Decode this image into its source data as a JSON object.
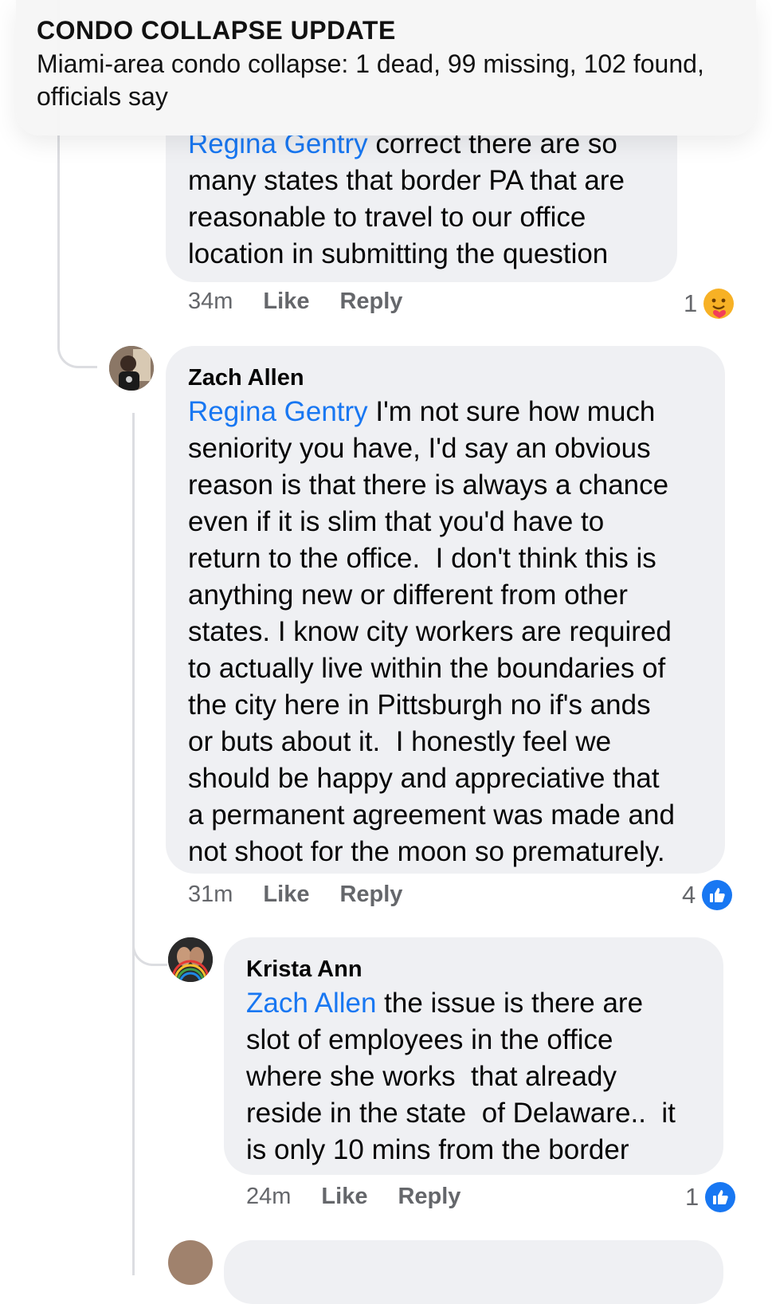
{
  "notification": {
    "title": "CONDO COLLAPSE UPDATE",
    "text": "Miami-area condo collapse: 1 dead, 99 missing, 102 found, officials say"
  },
  "comments": [
    {
      "author": "",
      "mention": "Regina Gentry",
      "text": " correct there are so\nmany states that border PA that are\nreasonable to travel to our office\nlocation in submitting the question",
      "time": "34m",
      "like": "Like",
      "reply": "Reply",
      "reaction_count": "1",
      "reaction": "care"
    },
    {
      "author": "Zach Allen",
      "mention": "Regina Gentry",
      "text": " I'm not sure how much\nseniority you have, I'd say an obvious\nreason is that there is always a chance\neven if it is slim that you'd have to\nreturn to the office.  I don't think this is\nanything new or different from other\nstates. I know city workers are required\nto actually live within the boundaries of\nthe city here in Pittsburgh no if's ands\nor buts about it.  I honestly feel we\nshould be happy and appreciative that\na permanent agreement was made and\nnot shoot for the moon so prematurely.",
      "time": "31m",
      "like": "Like",
      "reply": "Reply",
      "reaction_count": "4",
      "reaction": "like"
    },
    {
      "author": "Krista Ann",
      "mention": "Zach Allen",
      "text": " the issue is there are\nslot of employees in the office\nwhere she works  that already\nreside in the state  of Delaware..  it\nis only 10 mins from the border",
      "time": "24m",
      "like": "Like",
      "reply": "Reply",
      "reaction_count": "1",
      "reaction": "like"
    }
  ],
  "colors": {
    "mention": "#1877f2",
    "bubble": "#eff0f3",
    "meta": "#65676b"
  }
}
